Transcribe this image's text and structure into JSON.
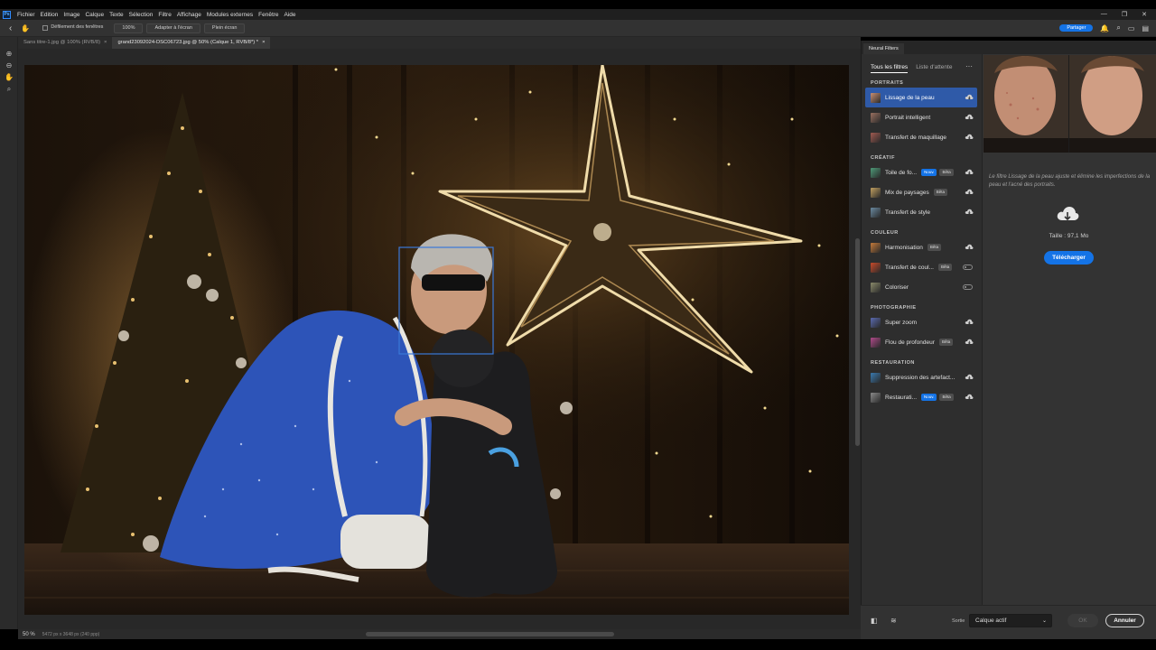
{
  "menubar": {
    "logo": "Ps",
    "items": [
      "Fichier",
      "Edition",
      "Image",
      "Calque",
      "Texte",
      "Sélection",
      "Filtre",
      "Affichage",
      "Modules externes",
      "Fenêtre",
      "Aide"
    ]
  },
  "options": {
    "scroll_all": "Défilement des fenêtres",
    "zoom": "100%",
    "fit": "Adapter à l'écran",
    "fill": "Plein écran",
    "share": "Partager"
  },
  "tabs": [
    {
      "label": "Sans titre-1.jpg @ 100% (RVB/8)",
      "close": "×"
    },
    {
      "label": "grand23092024-DSC06723.jpg @ 50% (Calque 1, RVB/8*) *",
      "close": "×"
    }
  ],
  "status": {
    "zoom": "50 %",
    "info": "5472 px x 3648 px (240 ppp)"
  },
  "neural_filters": {
    "panel_tab": "Neural Filters",
    "tab_all": "Tous les filtres",
    "tab_waitlist": "Liste d'attente",
    "more": "···",
    "categories": [
      {
        "name": "PORTRAITS",
        "items": [
          {
            "label": "Lissage de la peau",
            "badges": [],
            "control": "cloud",
            "selected": true,
            "color": "#c88f72"
          },
          {
            "label": "Portrait intelligent",
            "badges": [],
            "control": "cloud",
            "selected": false,
            "color": "#9a7060"
          },
          {
            "label": "Transfert de maquillage",
            "badges": [],
            "control": "cloud",
            "selected": false,
            "color": "#a05a50"
          }
        ]
      },
      {
        "name": "CRÉATIF",
        "items": [
          {
            "label": "Toile de fo...",
            "badges": [
              "Nouv.",
              "Bêta"
            ],
            "control": "cloud",
            "selected": false,
            "color": "#4e9a78"
          },
          {
            "label": "Mix de paysages",
            "badges": [
              "Bêta"
            ],
            "control": "cloud",
            "selected": false,
            "color": "#c2a060"
          },
          {
            "label": "Transfert de style",
            "badges": [],
            "control": "cloud",
            "selected": false,
            "color": "#6a8aa0"
          }
        ]
      },
      {
        "name": "COULEUR",
        "items": [
          {
            "label": "Harmonisation",
            "badges": [
              "Bêta"
            ],
            "control": "cloud",
            "selected": false,
            "color": "#c47a3a"
          },
          {
            "label": "Transfert de coul...",
            "badges": [
              "Bêta"
            ],
            "control": "toggle",
            "selected": false,
            "color": "#c84a2a"
          },
          {
            "label": "Coloriser",
            "badges": [],
            "control": "toggle",
            "selected": false,
            "color": "#8a8a6a"
          }
        ]
      },
      {
        "name": "PHOTOGRAPHIE",
        "items": [
          {
            "label": "Super zoom",
            "badges": [],
            "control": "cloud",
            "selected": false,
            "color": "#5a6ab0"
          },
          {
            "label": "Flou de profondeur",
            "badges": [
              "Bêta"
            ],
            "control": "cloud",
            "selected": false,
            "color": "#b04a8a"
          }
        ]
      },
      {
        "name": "RESTAURATION",
        "items": [
          {
            "label": "Suppression des artefact...",
            "badges": [],
            "control": "cloud",
            "selected": false,
            "color": "#3a7ab0"
          },
          {
            "label": "Restaurati...",
            "badges": [
              "Nouv.",
              "Bêta"
            ],
            "control": "cloud",
            "selected": false,
            "color": "#8a8a8a"
          }
        ]
      }
    ],
    "description": "Le filtre Lissage de la peau ajuste et élimine les imperfections de la peau et l'acné des portraits.",
    "size": "Taille : 97,1 Mo",
    "download": "Télécharger",
    "output_label": "Sortie",
    "output_value": "Calque actif",
    "ok": "OK",
    "cancel": "Annuler"
  }
}
